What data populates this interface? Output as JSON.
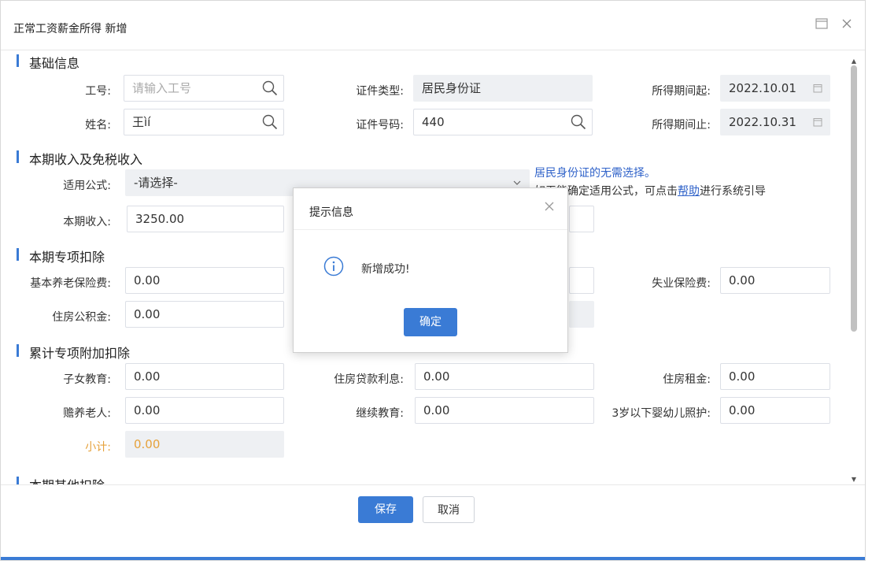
{
  "window": {
    "title": "正常工资薪金所得 新增"
  },
  "sections": {
    "basic": "基础信息",
    "income": "本期收入及免税收入",
    "special": "本期专项扣除",
    "cumulative": "累计专项附加扣除",
    "other": "本期其他扣除"
  },
  "basic": {
    "employee_id_label": "工号:",
    "employee_id_placeholder": "请输入工号",
    "name_label": "姓名:",
    "name_value": "王ìí",
    "id_type_label": "证件类型:",
    "id_type_value": "居民身份证",
    "id_number_label": "证件号码:",
    "id_number_value": "440",
    "period_start_label": "所得期间起:",
    "period_start_value": "2022.10.01",
    "period_end_label": "所得期间止:",
    "period_end_value": "2022.10.31"
  },
  "income": {
    "formula_label": "适用公式:",
    "formula_value": "-请选择-",
    "current_income_label": "本期收入:",
    "current_income_value": "3250.00",
    "hint_blue": "居民身份证的无需选择。",
    "hint_prefix": "如无能确定适用公式，可点击",
    "hint_link": "帮助",
    "hint_suffix": "进行系统引导"
  },
  "special": {
    "pension_label": "基本养老保险费:",
    "pension_value": "0.00",
    "housing_fund_label": "住房公积金:",
    "housing_fund_value": "0.00",
    "unemployment_label": "失业保险费:",
    "unemployment_value": "0.00"
  },
  "cumulative": {
    "children_edu_label": "子女教育:",
    "children_edu_value": "0.00",
    "elderly_label": "赡养老人:",
    "elderly_value": "0.00",
    "subtotal_label": "小计:",
    "subtotal_value": "0.00",
    "mortgage_label": "住房贷款利息:",
    "mortgage_value": "0.00",
    "continuing_edu_label": "继续教育:",
    "continuing_edu_value": "0.00",
    "rent_label": "住房租金:",
    "rent_value": "0.00",
    "infant_care_label": "3岁以下婴幼儿照护:",
    "infant_care_value": "0.00"
  },
  "footer": {
    "save": "保存",
    "cancel": "取消"
  },
  "dialog": {
    "title": "提示信息",
    "message": "新增成功!",
    "ok": "确定"
  },
  "colors": {
    "accent": "#3a7bd5",
    "subtotal": "#e6a23c",
    "link": "#2f62c9"
  }
}
